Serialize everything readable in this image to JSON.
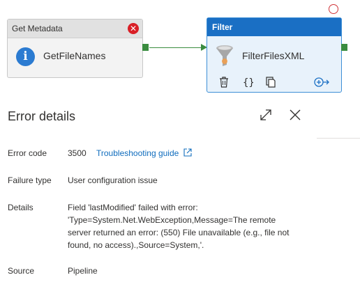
{
  "pipeline": {
    "get_metadata": {
      "type_label": "Get Metadata",
      "name": "GetFileNames",
      "error_icon": "error-x-icon",
      "info_icon": "info-icon"
    },
    "filter": {
      "type_label": "Filter",
      "name": "FilterFilesXML",
      "icons": [
        "delete-icon",
        "code-braces-icon",
        "copy-icon",
        "add-output-icon"
      ]
    }
  },
  "error_panel": {
    "title": "Error details",
    "fields": {
      "error_code": {
        "label": "Error code",
        "value": "3500"
      },
      "troubleshooting_link": "Troubleshooting guide",
      "failure_type": {
        "label": "Failure type",
        "value": "User configuration issue"
      },
      "details": {
        "label": "Details",
        "line1": "Field 'lastModified' failed with error:",
        "line2": "'Type=System.Net.WebException,Message=The remote",
        "line3": "server returned an error: (550) File unavailable (e.g., file not",
        "line4": "found, no access).,Source=System,'."
      },
      "source": {
        "label": "Source",
        "value": "Pipeline"
      }
    }
  },
  "colors": {
    "error_red": "#d91f26",
    "success_green": "#3a8c3f",
    "filter_header_blue": "#1a6fc4",
    "link_blue": "#0f6cbd"
  }
}
